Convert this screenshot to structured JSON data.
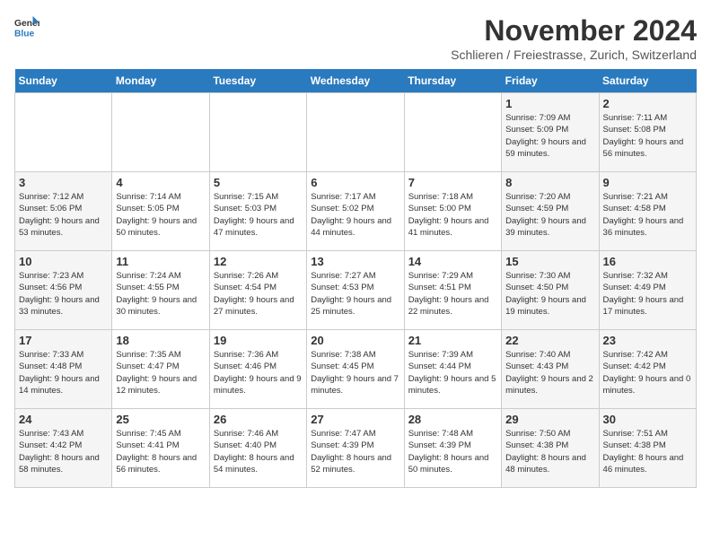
{
  "logo": {
    "general": "General",
    "blue": "Blue"
  },
  "title": "November 2024",
  "subtitle": "Schlieren / Freiestrasse, Zurich, Switzerland",
  "days_of_week": [
    "Sunday",
    "Monday",
    "Tuesday",
    "Wednesday",
    "Thursday",
    "Friday",
    "Saturday"
  ],
  "weeks": [
    [
      {
        "day": "",
        "sunrise": "",
        "sunset": "",
        "daylight": "",
        "type": "empty"
      },
      {
        "day": "",
        "sunrise": "",
        "sunset": "",
        "daylight": "",
        "type": "empty"
      },
      {
        "day": "",
        "sunrise": "",
        "sunset": "",
        "daylight": "",
        "type": "empty"
      },
      {
        "day": "",
        "sunrise": "",
        "sunset": "",
        "daylight": "",
        "type": "empty"
      },
      {
        "day": "",
        "sunrise": "",
        "sunset": "",
        "daylight": "",
        "type": "empty"
      },
      {
        "day": "1",
        "sunrise": "Sunrise: 7:09 AM",
        "sunset": "Sunset: 5:09 PM",
        "daylight": "Daylight: 9 hours and 59 minutes.",
        "type": "weekend"
      },
      {
        "day": "2",
        "sunrise": "Sunrise: 7:11 AM",
        "sunset": "Sunset: 5:08 PM",
        "daylight": "Daylight: 9 hours and 56 minutes.",
        "type": "weekend"
      }
    ],
    [
      {
        "day": "3",
        "sunrise": "Sunrise: 7:12 AM",
        "sunset": "Sunset: 5:06 PM",
        "daylight": "Daylight: 9 hours and 53 minutes.",
        "type": "weekend"
      },
      {
        "day": "4",
        "sunrise": "Sunrise: 7:14 AM",
        "sunset": "Sunset: 5:05 PM",
        "daylight": "Daylight: 9 hours and 50 minutes.",
        "type": "weekday"
      },
      {
        "day": "5",
        "sunrise": "Sunrise: 7:15 AM",
        "sunset": "Sunset: 5:03 PM",
        "daylight": "Daylight: 9 hours and 47 minutes.",
        "type": "weekday"
      },
      {
        "day": "6",
        "sunrise": "Sunrise: 7:17 AM",
        "sunset": "Sunset: 5:02 PM",
        "daylight": "Daylight: 9 hours and 44 minutes.",
        "type": "weekday"
      },
      {
        "day": "7",
        "sunrise": "Sunrise: 7:18 AM",
        "sunset": "Sunset: 5:00 PM",
        "daylight": "Daylight: 9 hours and 41 minutes.",
        "type": "weekday"
      },
      {
        "day": "8",
        "sunrise": "Sunrise: 7:20 AM",
        "sunset": "Sunset: 4:59 PM",
        "daylight": "Daylight: 9 hours and 39 minutes.",
        "type": "weekend"
      },
      {
        "day": "9",
        "sunrise": "Sunrise: 7:21 AM",
        "sunset": "Sunset: 4:58 PM",
        "daylight": "Daylight: 9 hours and 36 minutes.",
        "type": "weekend"
      }
    ],
    [
      {
        "day": "10",
        "sunrise": "Sunrise: 7:23 AM",
        "sunset": "Sunset: 4:56 PM",
        "daylight": "Daylight: 9 hours and 33 minutes.",
        "type": "weekend"
      },
      {
        "day": "11",
        "sunrise": "Sunrise: 7:24 AM",
        "sunset": "Sunset: 4:55 PM",
        "daylight": "Daylight: 9 hours and 30 minutes.",
        "type": "weekday"
      },
      {
        "day": "12",
        "sunrise": "Sunrise: 7:26 AM",
        "sunset": "Sunset: 4:54 PM",
        "daylight": "Daylight: 9 hours and 27 minutes.",
        "type": "weekday"
      },
      {
        "day": "13",
        "sunrise": "Sunrise: 7:27 AM",
        "sunset": "Sunset: 4:53 PM",
        "daylight": "Daylight: 9 hours and 25 minutes.",
        "type": "weekday"
      },
      {
        "day": "14",
        "sunrise": "Sunrise: 7:29 AM",
        "sunset": "Sunset: 4:51 PM",
        "daylight": "Daylight: 9 hours and 22 minutes.",
        "type": "weekday"
      },
      {
        "day": "15",
        "sunrise": "Sunrise: 7:30 AM",
        "sunset": "Sunset: 4:50 PM",
        "daylight": "Daylight: 9 hours and 19 minutes.",
        "type": "weekend"
      },
      {
        "day": "16",
        "sunrise": "Sunrise: 7:32 AM",
        "sunset": "Sunset: 4:49 PM",
        "daylight": "Daylight: 9 hours and 17 minutes.",
        "type": "weekend"
      }
    ],
    [
      {
        "day": "17",
        "sunrise": "Sunrise: 7:33 AM",
        "sunset": "Sunset: 4:48 PM",
        "daylight": "Daylight: 9 hours and 14 minutes.",
        "type": "weekend"
      },
      {
        "day": "18",
        "sunrise": "Sunrise: 7:35 AM",
        "sunset": "Sunset: 4:47 PM",
        "daylight": "Daylight: 9 hours and 12 minutes.",
        "type": "weekday"
      },
      {
        "day": "19",
        "sunrise": "Sunrise: 7:36 AM",
        "sunset": "Sunset: 4:46 PM",
        "daylight": "Daylight: 9 hours and 9 minutes.",
        "type": "weekday"
      },
      {
        "day": "20",
        "sunrise": "Sunrise: 7:38 AM",
        "sunset": "Sunset: 4:45 PM",
        "daylight": "Daylight: 9 hours and 7 minutes.",
        "type": "weekday"
      },
      {
        "day": "21",
        "sunrise": "Sunrise: 7:39 AM",
        "sunset": "Sunset: 4:44 PM",
        "daylight": "Daylight: 9 hours and 5 minutes.",
        "type": "weekday"
      },
      {
        "day": "22",
        "sunrise": "Sunrise: 7:40 AM",
        "sunset": "Sunset: 4:43 PM",
        "daylight": "Daylight: 9 hours and 2 minutes.",
        "type": "weekend"
      },
      {
        "day": "23",
        "sunrise": "Sunrise: 7:42 AM",
        "sunset": "Sunset: 4:42 PM",
        "daylight": "Daylight: 9 hours and 0 minutes.",
        "type": "weekend"
      }
    ],
    [
      {
        "day": "24",
        "sunrise": "Sunrise: 7:43 AM",
        "sunset": "Sunset: 4:42 PM",
        "daylight": "Daylight: 8 hours and 58 minutes.",
        "type": "weekend"
      },
      {
        "day": "25",
        "sunrise": "Sunrise: 7:45 AM",
        "sunset": "Sunset: 4:41 PM",
        "daylight": "Daylight: 8 hours and 56 minutes.",
        "type": "weekday"
      },
      {
        "day": "26",
        "sunrise": "Sunrise: 7:46 AM",
        "sunset": "Sunset: 4:40 PM",
        "daylight": "Daylight: 8 hours and 54 minutes.",
        "type": "weekday"
      },
      {
        "day": "27",
        "sunrise": "Sunrise: 7:47 AM",
        "sunset": "Sunset: 4:39 PM",
        "daylight": "Daylight: 8 hours and 52 minutes.",
        "type": "weekday"
      },
      {
        "day": "28",
        "sunrise": "Sunrise: 7:48 AM",
        "sunset": "Sunset: 4:39 PM",
        "daylight": "Daylight: 8 hours and 50 minutes.",
        "type": "weekday"
      },
      {
        "day": "29",
        "sunrise": "Sunrise: 7:50 AM",
        "sunset": "Sunset: 4:38 PM",
        "daylight": "Daylight: 8 hours and 48 minutes.",
        "type": "weekend"
      },
      {
        "day": "30",
        "sunrise": "Sunrise: 7:51 AM",
        "sunset": "Sunset: 4:38 PM",
        "daylight": "Daylight: 8 hours and 46 minutes.",
        "type": "weekend"
      }
    ]
  ]
}
